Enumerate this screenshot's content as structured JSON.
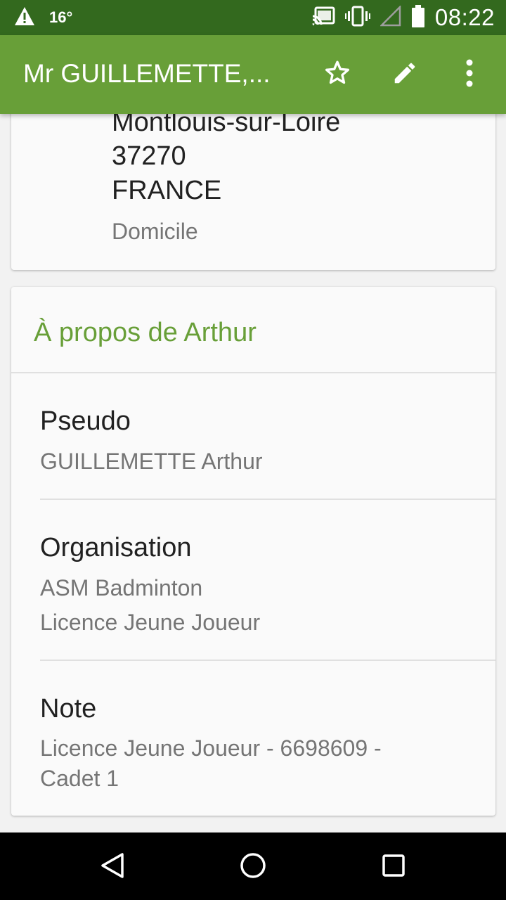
{
  "status_bar": {
    "temperature": "16°",
    "time": "08:22",
    "icons": [
      "warning-icon",
      "cast-icon",
      "vibrate-icon",
      "signal-icon",
      "battery-icon"
    ]
  },
  "app_bar": {
    "title": "Mr GUILLEMETTE,...",
    "actions": [
      "star-icon",
      "edit-icon",
      "more-vert-icon"
    ]
  },
  "address": {
    "city": "Montlouis-sur-Loire",
    "postal_code": "37270",
    "country": "FRANCE",
    "type": "Domicile"
  },
  "about": {
    "title": "À propos de Arthur",
    "pseudo_label": "Pseudo",
    "pseudo_value": "GUILLEMETTE Arthur",
    "organisation_label": "Organisation",
    "organisation_name": "ASM Badminton",
    "organisation_title": "Licence Jeune Joueur",
    "note_label": "Note",
    "note_line1": "Licence Jeune Joueur - 6698609 -",
    "note_line2": "Cadet 1"
  },
  "nav": [
    "back-icon",
    "home-icon",
    "recents-icon"
  ],
  "colors": {
    "status_bar": "#33691e",
    "app_bar": "#689f38",
    "accent": "#689f38"
  }
}
